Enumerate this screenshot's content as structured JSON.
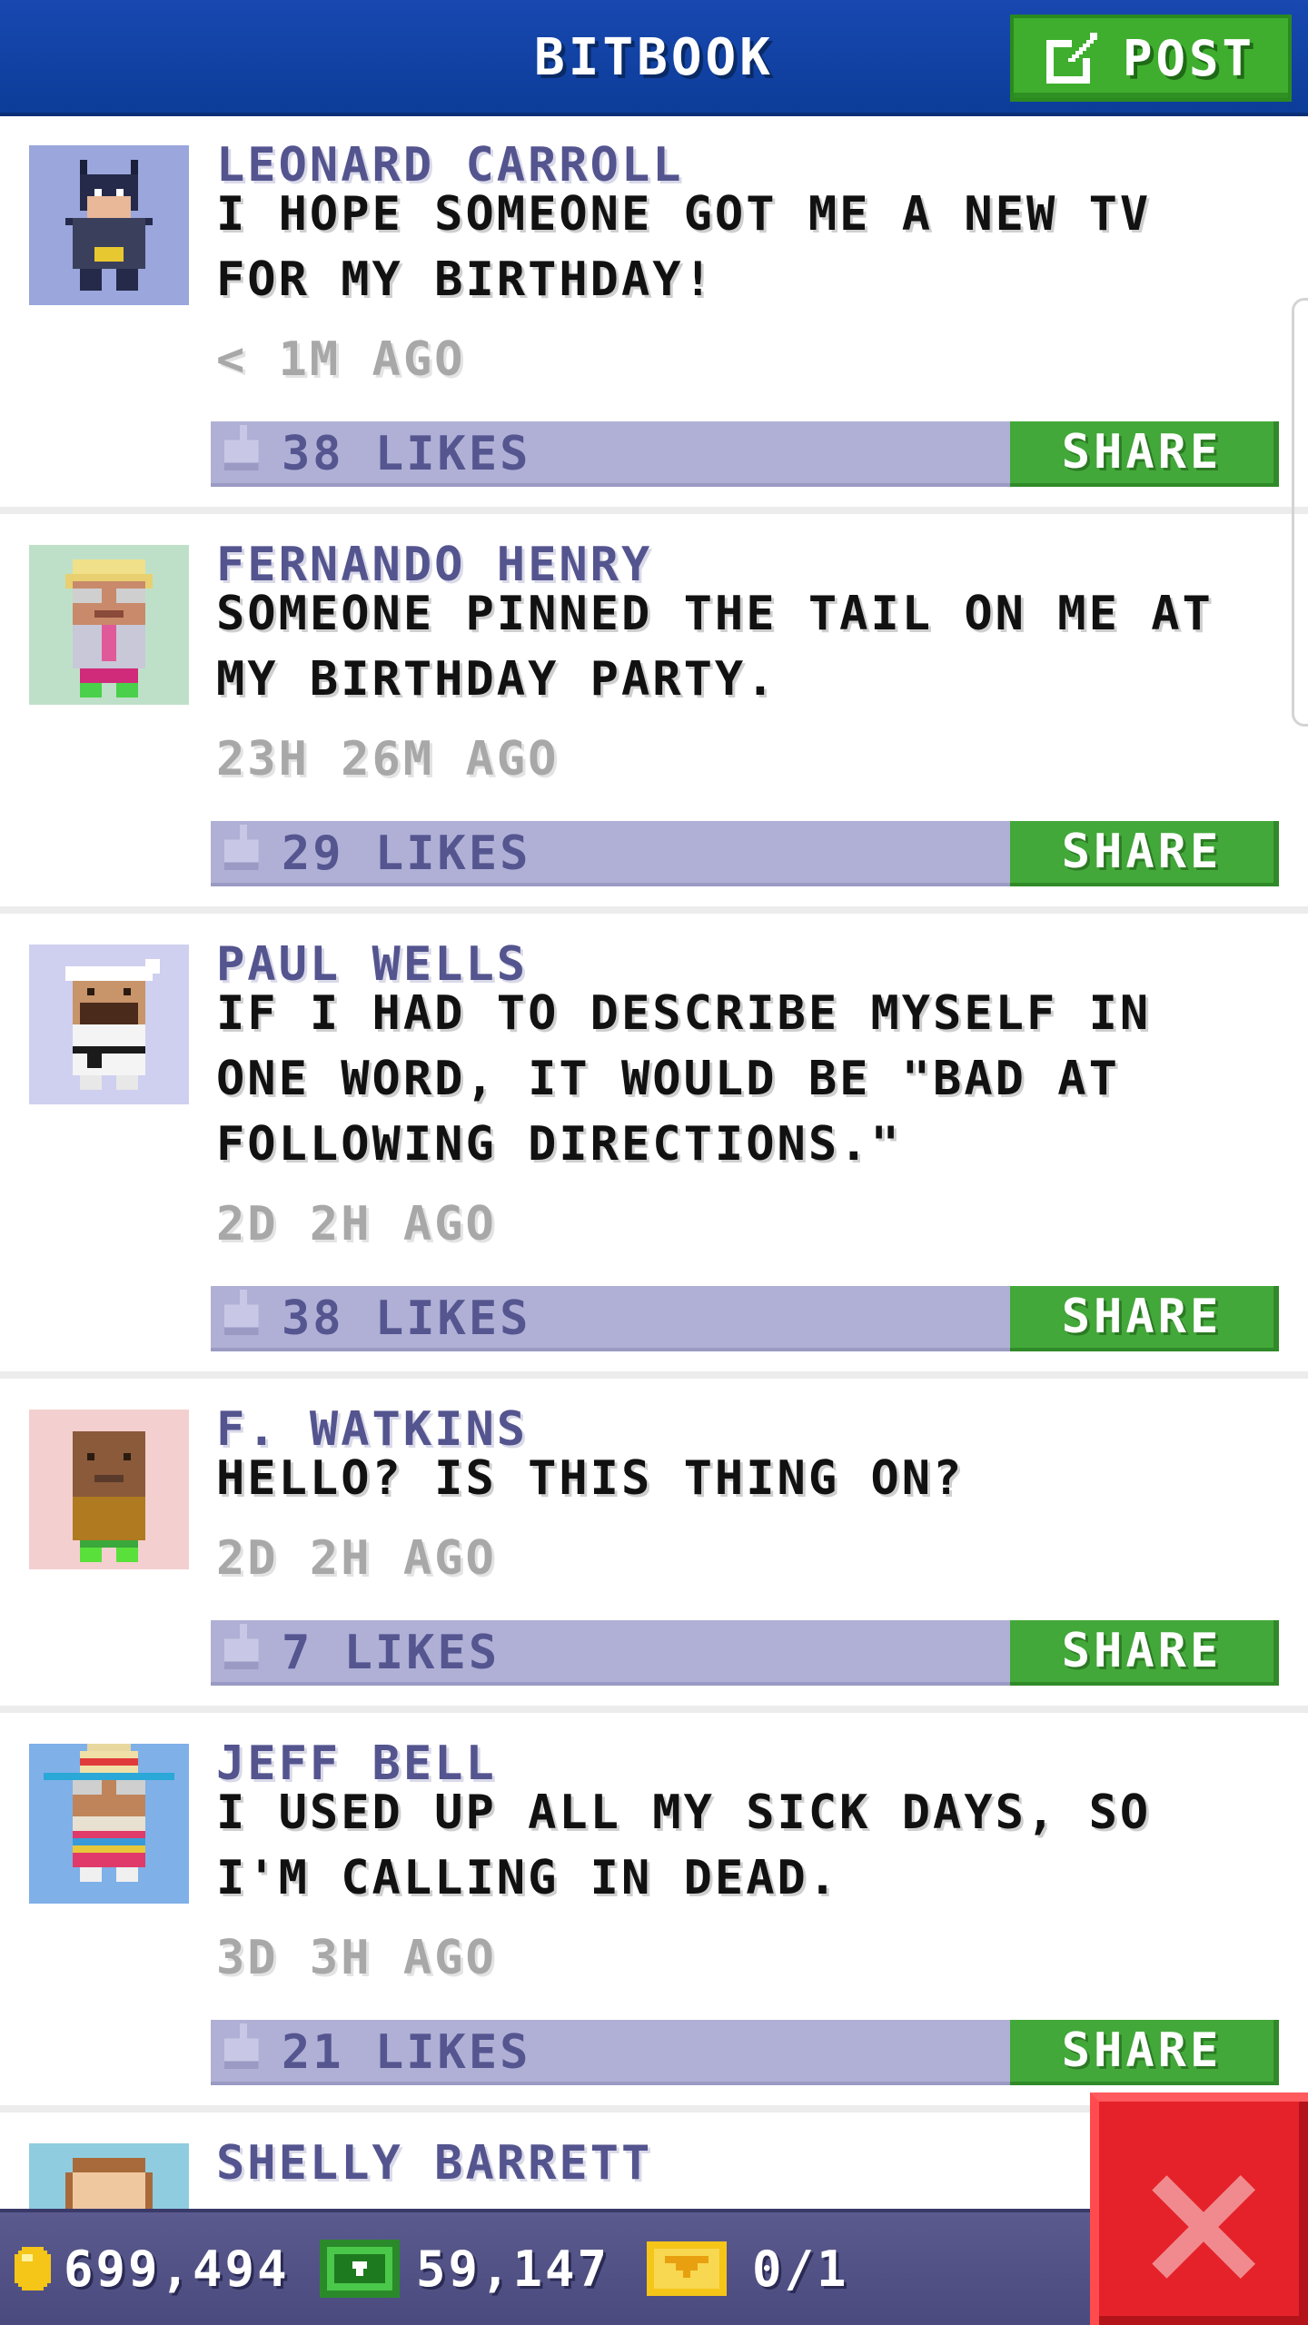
{
  "header": {
    "title": "BITBOOK",
    "post_label": "POST"
  },
  "posts": [
    {
      "author": "LEONARD CARROLL",
      "message": "I HOPE SOMEONE GOT ME A NEW TV FOR MY BIRTHDAY!",
      "time": "< 1M AGO",
      "likes": "38 LIKES",
      "share_label": "SHARE",
      "avatar_bg": "#9aa6dc",
      "avatar": "batman-costume-avatar"
    },
    {
      "author": "FERNANDO HENRY",
      "message": "SOMEONE PINNED THE TAIL ON ME AT MY BIRTHDAY PARTY.",
      "time": "23H 26M AGO",
      "likes": "29 LIKES",
      "share_label": "SHARE",
      "avatar_bg": "#bfe0c8",
      "avatar": "blonde-man-glasses-avatar"
    },
    {
      "author": "PAUL WELLS",
      "message": "IF I HAD TO DESCRIBE MYSELF IN ONE WORD, IT WOULD BE \"BAD AT FOLLOWING DIRECTIONS.\"",
      "time": "2D 2H AGO",
      "likes": "38 LIKES",
      "share_label": "SHARE",
      "avatar_bg": "#cfcff0",
      "avatar": "karate-man-headband-avatar"
    },
    {
      "author": "F. WATKINS",
      "message": "HELLO? IS THIS THING ON?",
      "time": "2D 2H AGO",
      "likes": "7 LIKES",
      "share_label": "SHARE",
      "avatar_bg": "#f4cfcf",
      "avatar": "bald-man-avatar"
    },
    {
      "author": "JEFF BELL",
      "message": "I USED UP ALL MY SICK DAYS, SO I'M CALLING IN DEAD.",
      "time": "3D 3H AGO",
      "likes": "21 LIKES",
      "share_label": "SHARE",
      "avatar_bg": "#7fb0e8",
      "avatar": "sombrero-man-avatar"
    },
    {
      "author": "SHELLY BARRETT",
      "message": "",
      "time": "",
      "likes": "",
      "share_label": "",
      "avatar_bg": "#8fcce0",
      "avatar": "woman-avatar"
    }
  ],
  "status": {
    "coins": "699,494",
    "bux": "59,147",
    "tickets": "0/1"
  },
  "colors": {
    "header_blue": "#0c3d99",
    "post_green": "#3fae2e",
    "likes_bar": "#b0b0d6",
    "author_purple": "#54548f",
    "close_red": "#e5222a"
  }
}
